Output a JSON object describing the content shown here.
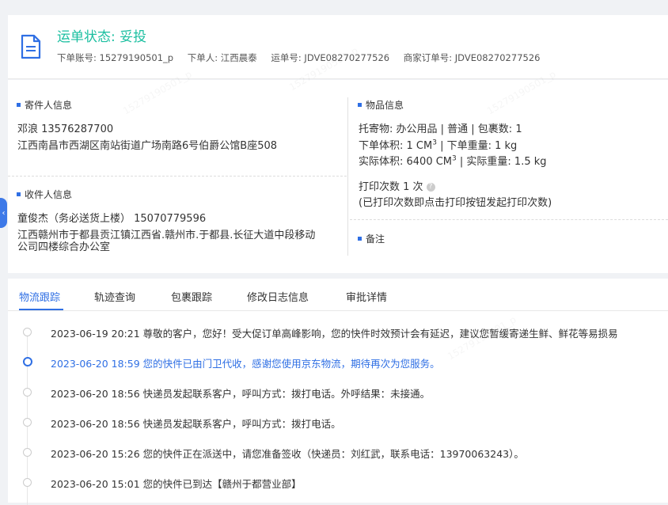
{
  "header": {
    "status": "运单状态: 妥投",
    "account": "下单账号: 15279190501_p",
    "orderer": "下单人: 江西晨泰",
    "waybill": "运单号: JDVE08270277526",
    "merchant_order": "商家订单号: JDVE08270277526"
  },
  "sender": {
    "title": "寄件人信息",
    "name_phone": "邓浪   13576287700",
    "address": "江西南昌市西湖区南站街道广场南路6号伯爵公馆B座508"
  },
  "receiver": {
    "title": "收件人信息",
    "name_phone": "童俊杰（务必送货上楼）   15070779596",
    "address_line1": "江西赣州市于都县贡江镇江西省.赣州市.于都县.长征大道中段移动",
    "address_line2": "公司四楼综合办公室"
  },
  "goods": {
    "title": "物品信息",
    "consign": "托寄物:  办公用品 | 普通  |  包裹数:  1",
    "order_volume_label": "下单体积:   1 CM",
    "order_weight": " |  下单重量:   1 kg",
    "actual_volume_label": "实际体积:    6400 CM",
    "actual_weight": " |  实际重量:   1.5 kg",
    "cube_sup": "3",
    "print_count": "打印次数   1 次",
    "print_note": "(已打印次数即点击打印按钮发起打印次数)"
  },
  "remark": {
    "title": "备注"
  },
  "tabs": [
    "物流跟踪",
    "轨迹查询",
    "包裹跟踪",
    "修改日志信息",
    "审批详情"
  ],
  "timeline": [
    {
      "text": "2023-06-19 20:21  尊敬的客户，您好！受大促订单高峰影响，您的快件时效预计会有延迟，建议您暂缓寄递生鲜、鲜花等易损易",
      "active": false
    },
    {
      "text": "2023-06-20 18:59  您的快件已由门卫代收，感谢您使用京东物流，期待再次为您服务。",
      "active": true
    },
    {
      "text": "2023-06-20 18:56  快递员发起联系客户，呼叫方式：拨打电话。外呼结果：未接通。",
      "active": false
    },
    {
      "text": "2023-06-20 18:56  快递员发起联系客户，呼叫方式：拨打电话。",
      "active": false
    },
    {
      "text": "2023-06-20 15:26  您的快件正在派送中，请您准备签收（快递员：刘红武，联系电话：13970063243）。",
      "active": false
    },
    {
      "text": "2023-06-20 15:01  您的快件已到达【赣州于都营业部】",
      "active": false
    }
  ],
  "watermark": "15279190501_p",
  "colors": {
    "accent": "#2f6fe4",
    "status_green": "#1bbfa0"
  }
}
